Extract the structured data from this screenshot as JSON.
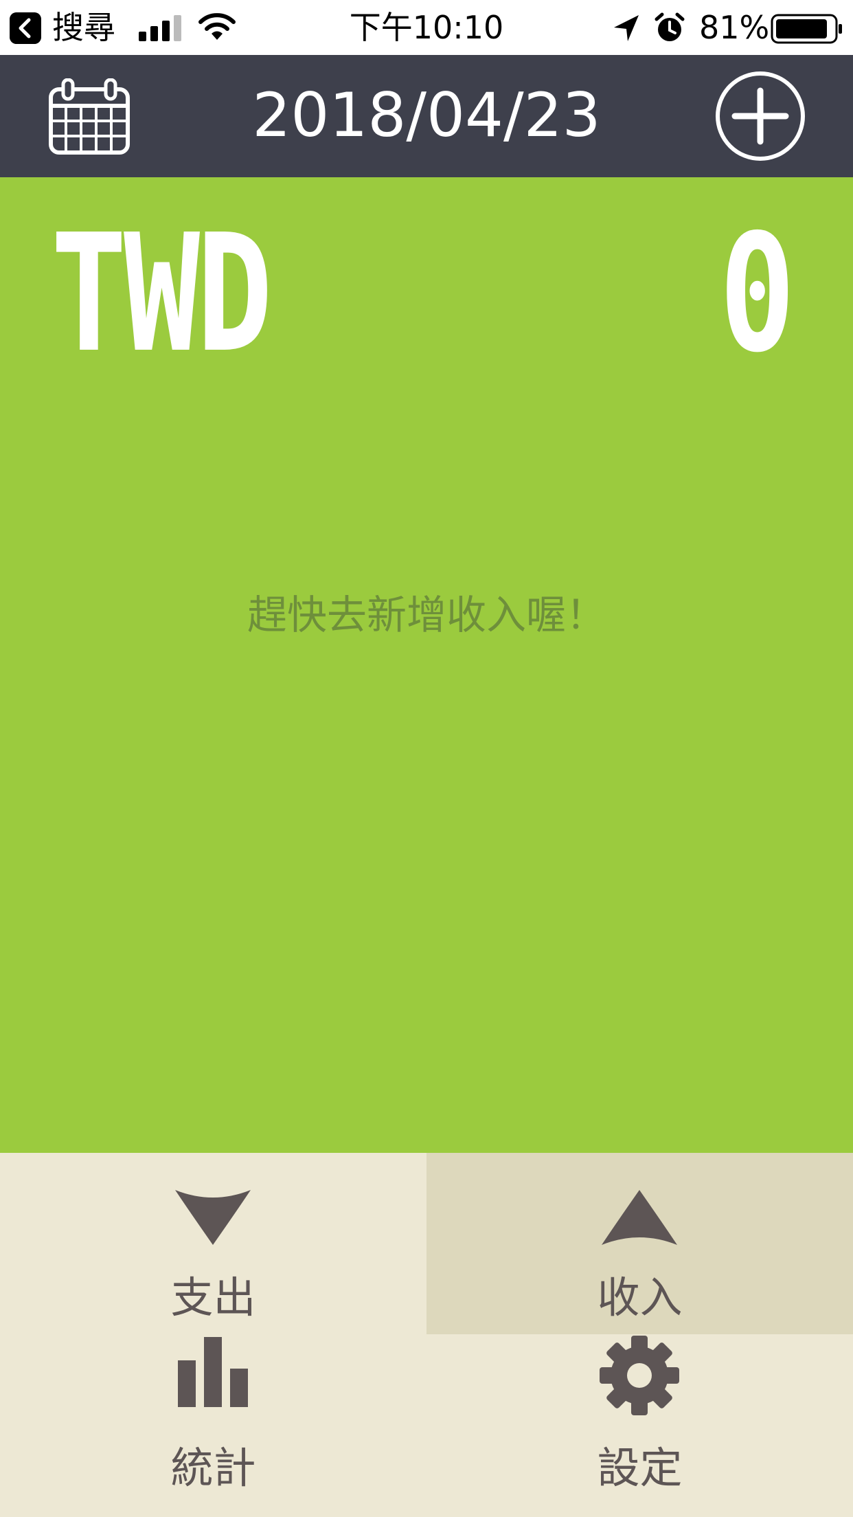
{
  "status_bar": {
    "back_label": "搜尋",
    "time": "下午10:10",
    "battery": "81%"
  },
  "header": {
    "date": "2018/04/23",
    "calendar_icon": "calendar-icon",
    "add_icon": "plus-circle-icon"
  },
  "summary": {
    "currency": "TWD",
    "total": "0"
  },
  "empty_message": "趕快去新增收入喔！",
  "menu": {
    "items": [
      {
        "label": "支出",
        "icon": "chevron-down-icon",
        "active": false
      },
      {
        "label": "收入",
        "icon": "chevron-up-icon",
        "active": true
      },
      {
        "label": "統計",
        "icon": "bar-chart-icon",
        "active": false
      },
      {
        "label": "設定",
        "icon": "gear-icon",
        "active": false
      }
    ]
  },
  "colors": {
    "header_bg": "#3e404c",
    "main_bg": "#9bcb3e",
    "menu_bg": "#ede8d4",
    "menu_active_bg": "#ddd8bc",
    "menu_fg": "#5d5555"
  }
}
